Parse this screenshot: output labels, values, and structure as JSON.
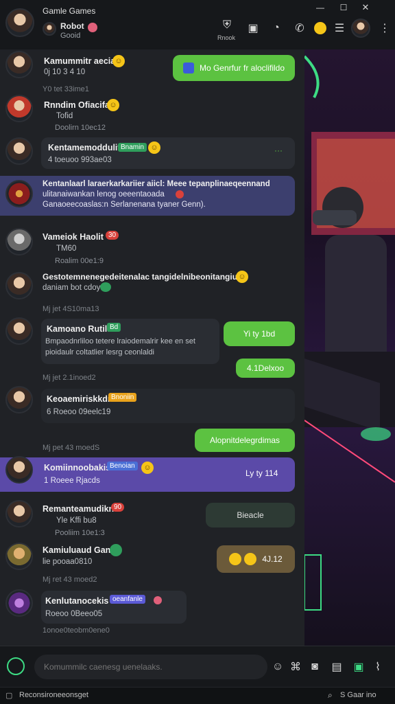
{
  "window": {
    "title": "Gamle Games"
  },
  "header": {
    "profile_name": "Robot",
    "profile_sub": "Gooid",
    "shield_label": "Rnook"
  },
  "messages": [
    {
      "name": "Kamummitr aeciaih",
      "sub": "0j 10 3 4 10",
      "bubble": "Mo Genrfur fr aloclifildo"
    },
    {
      "sep": "Y0 tet 33ime1"
    },
    {
      "name": "Rnndim Ofiacifa",
      "sub": "Tofid",
      "ts": "Doolirn 10ec12"
    },
    {
      "name": "Kentamemoddulitan",
      "badge": "Bnamin",
      "sub": "4 toeuoo 993ae03"
    },
    {
      "name": "Kentanlaarl laraerkarkariier aiicl: Meee tepanplinaeqeennand",
      "line2": "ulitanaiwankan lenog oeeentaoada",
      "line3": "Ganaoeecoaslas:n Serlanenana tyaner Genn)."
    },
    {
      "name": "Vameiok Haolit",
      "badge": "30",
      "sub": "TM60",
      "ts": "Roalim 00e1:9"
    },
    {
      "name": "Gestotemnenegedeitenalac tangidelnibeonitangiun",
      "line2": "daniam bot cdoy"
    },
    {
      "sep": "Mj jet 4S10ma13"
    },
    {
      "name": "Kamoano Rutilat",
      "badge": "Bd",
      "line2": "Bmpaodnrliloo tetere lraiodemalrir kee en set",
      "line3": "pioidaulr coltatlier lesrg ceonlaldi",
      "bubble": "Yi ty 1bd"
    },
    {
      "bubble": "4.1Delxoo"
    },
    {
      "sep": "Mj jet 2.1inoed2"
    },
    {
      "name": "Keoaemiriskkdn",
      "badge": "Bnoniin",
      "sub": "6 Roeoo 09eelc19"
    },
    {
      "bubble": "Alopnitdelegrdimas"
    },
    {
      "sep": "Mj pet 43 moedS"
    },
    {
      "name": "Komiinnoobakis",
      "badge": "Benoian",
      "sub": "1 Roeee Rjacds",
      "bubble": "Ly ty 114"
    },
    {
      "name": "Remanteamudikn",
      "badge": "90",
      "sub": "Yle Kffi bu8",
      "ts": "Pooliim 10e1:3",
      "bubble": "Bieacle"
    },
    {
      "name": "Kamiuluaud Gante",
      "sub": "lie pooaa0810",
      "bubble": "4J.12"
    },
    {
      "sep": "Mj ret 43 moed2"
    },
    {
      "name": "Kenlutanocekis",
      "badge": "oeanfanle",
      "sub": "Roeoo 0Beeo05"
    },
    {
      "sep": "1onoe0teobm0ene0"
    }
  ],
  "composer": {
    "placeholder": "Komummilc caenesg uenelaaks."
  },
  "statusbar": {
    "left": "Reconsironeeonsget",
    "right": "S Gaar ino"
  },
  "colors": {
    "accent_green": "#5cc241",
    "purple_highlight": "#5b4aa8",
    "badge_red": "#d9413b",
    "badge_green": "#2f9e5c"
  }
}
